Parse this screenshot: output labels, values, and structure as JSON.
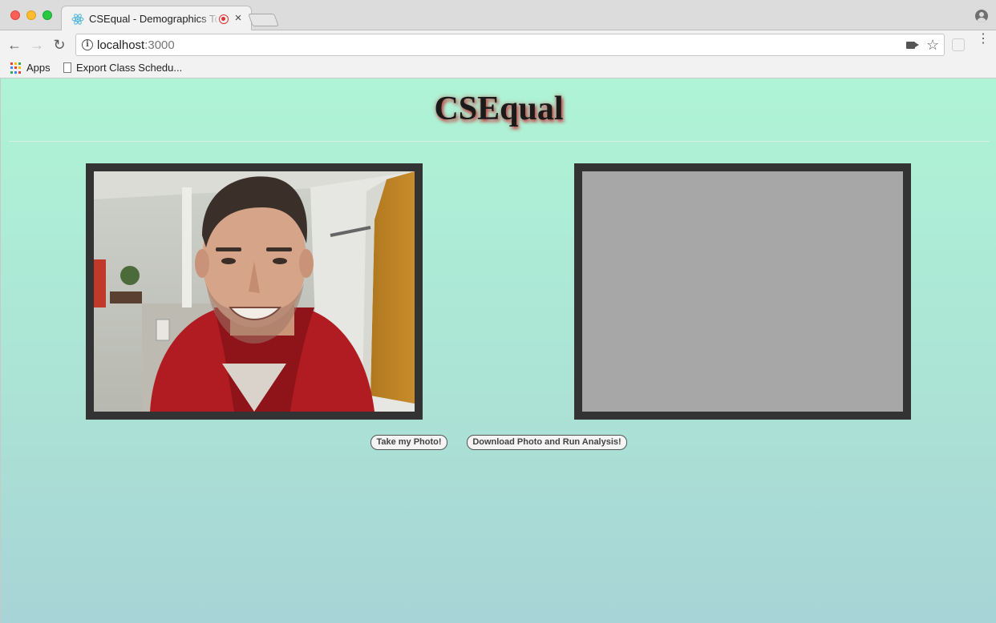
{
  "browser": {
    "tab_title": "CSEqual - Demographics To",
    "tab_close": "×",
    "url_host": "localhost",
    "url_port": ":3000",
    "nav": {
      "back": "←",
      "forward": "→",
      "reload": "↻"
    },
    "omnibox_icons": [
      "info-icon",
      "camera-icon",
      "star-icon"
    ],
    "star": "☆",
    "menu": "⋮",
    "info": "i"
  },
  "bookmarks": {
    "apps_label": "Apps",
    "items": [
      {
        "label": "Export Class Schedu..."
      }
    ]
  },
  "page": {
    "title": "CSEqual",
    "webcam": {
      "content": "webcam-feed-photo"
    },
    "canvas": {
      "content": "empty-capture-canvas"
    },
    "buttons": {
      "take_photo": "Take my Photo!",
      "download_analyze": "Download Photo and Run Analysis!"
    }
  },
  "colors": {
    "page_gradient_top": "#aff4d6",
    "page_gradient_bottom": "#a7d4d6",
    "frame": "#333333",
    "canvas": "#a7a7a7",
    "title_glow": "#c04545"
  }
}
